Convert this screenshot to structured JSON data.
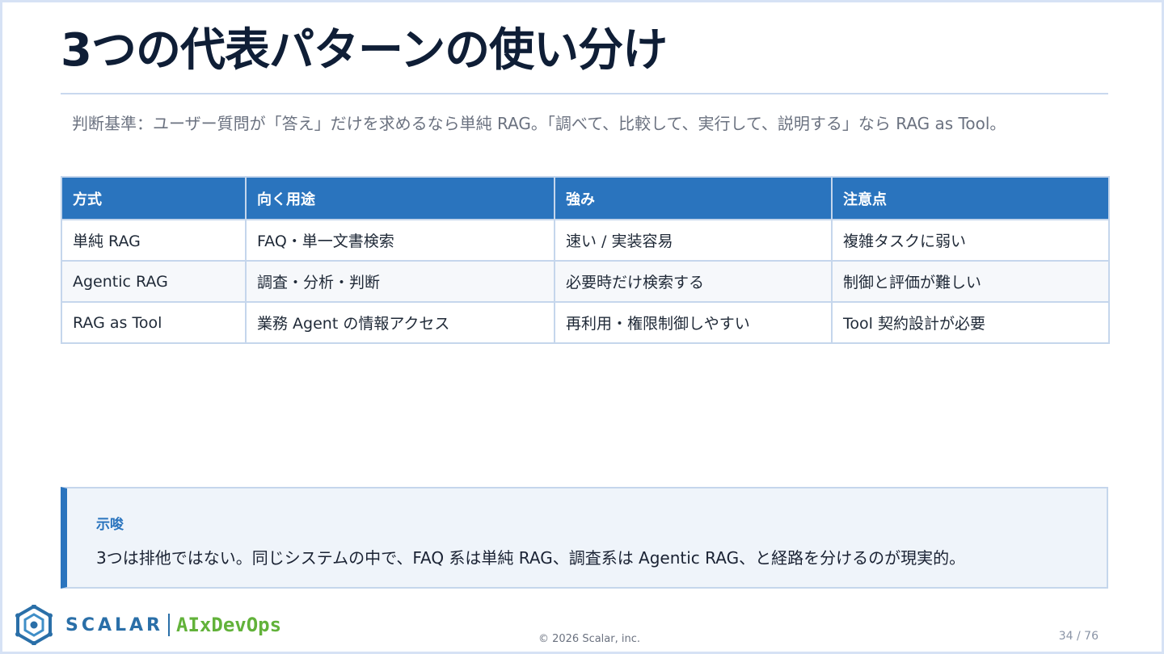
{
  "slide": {
    "title": "3つの代表パターンの使い分け",
    "criteria": "判断基準：ユーザー質問が「答え」だけを求めるなら単純 RAG。「調べて、比較して、実行して、説明する」なら RAG as Tool。"
  },
  "table": {
    "headers": [
      "方式",
      "向く用途",
      "強み",
      "注意点"
    ],
    "rows": [
      [
        "単純 RAG",
        "FAQ・単一文書検索",
        "速い / 実装容易",
        "複雑タスクに弱い"
      ],
      [
        "Agentic RAG",
        "調査・分析・判断",
        "必要時だけ検索する",
        "制御と評価が難しい"
      ],
      [
        "RAG as Tool",
        "業務 Agent の情報アクセス",
        "再利用・権限制御しやすい",
        "Tool 契約設計が必要"
      ]
    ]
  },
  "note": {
    "label": "示唆",
    "text": "3つは排他ではない。同じシステムの中で、FAQ 系は単純 RAG、調査系は Agentic RAG、と経路を分けるのが現実的。"
  },
  "footer": {
    "logo_word": "SCALAR",
    "logo_tagline": "AIxDevOps",
    "copyright": "© 2026 Scalar, inc.",
    "page": "34 / 76"
  },
  "colors": {
    "accent": "#2a74be",
    "title": "#0f1e36",
    "brand_blue": "#2a6fa8",
    "brand_green": "#62b23a"
  }
}
